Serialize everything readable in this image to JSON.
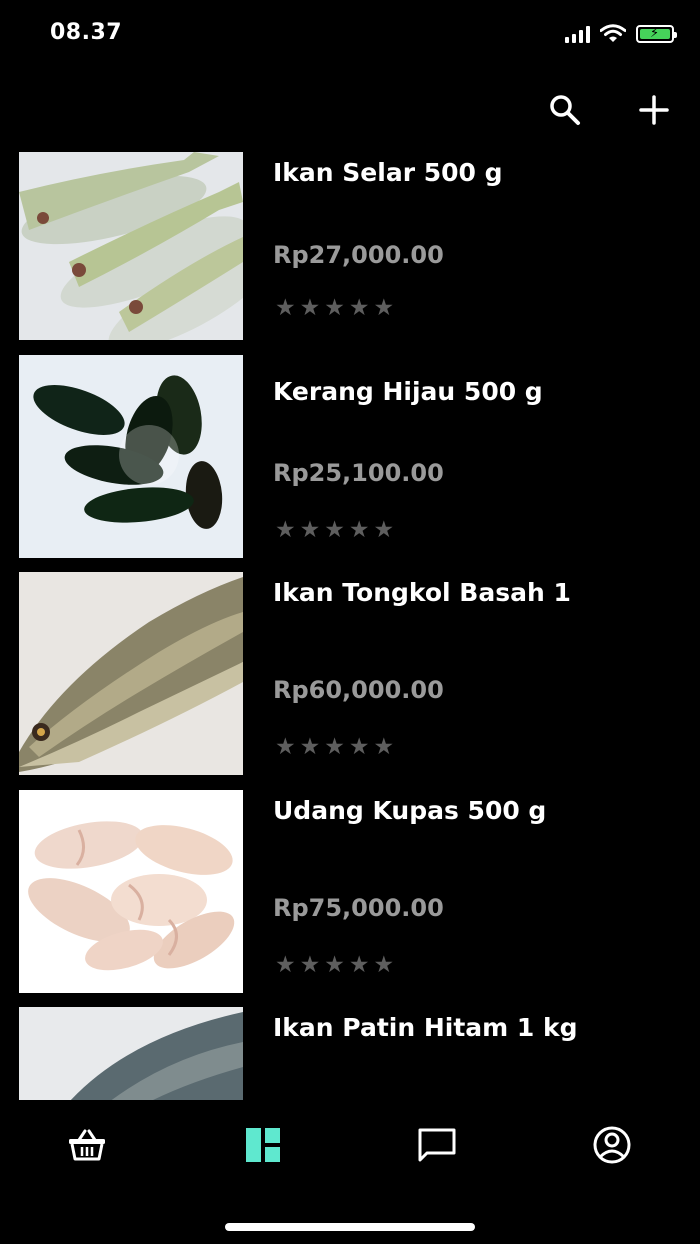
{
  "status": {
    "time": "08.37"
  },
  "colors": {
    "background": "#000000",
    "accent": "#5fe8cf",
    "price": "#9a9a9a",
    "star": "#5e5e5e",
    "battery": "#46d35a"
  },
  "topbar": {
    "icons": [
      "search-icon",
      "plus-icon"
    ]
  },
  "products": [
    {
      "name": "Ikan Selar 500 g",
      "price": "Rp27,000.00",
      "rating": 0,
      "image": "mackerel-fish-photo"
    },
    {
      "name": "Kerang Hijau 500 g",
      "price": "Rp25,100.00",
      "rating": 0,
      "image": "green-mussel-photo"
    },
    {
      "name": "Ikan Tongkol Basah 1",
      "price": "Rp60,000.00",
      "rating": 0,
      "image": "tuna-fish-photo"
    },
    {
      "name": "Udang Kupas 500 g",
      "price": "Rp75,000.00",
      "rating": 0,
      "image": "peeled-shrimp-photo"
    },
    {
      "name": "Ikan Patin Hitam 1 kg",
      "price": "",
      "rating": 0,
      "image": "catfish-photo"
    }
  ],
  "tabs": [
    {
      "id": "shop",
      "icon": "basket-icon",
      "active": false
    },
    {
      "id": "products",
      "icon": "dashboard-icon",
      "active": true
    },
    {
      "id": "chat",
      "icon": "chat-icon",
      "active": false
    },
    {
      "id": "account",
      "icon": "account-icon",
      "active": false
    }
  ]
}
